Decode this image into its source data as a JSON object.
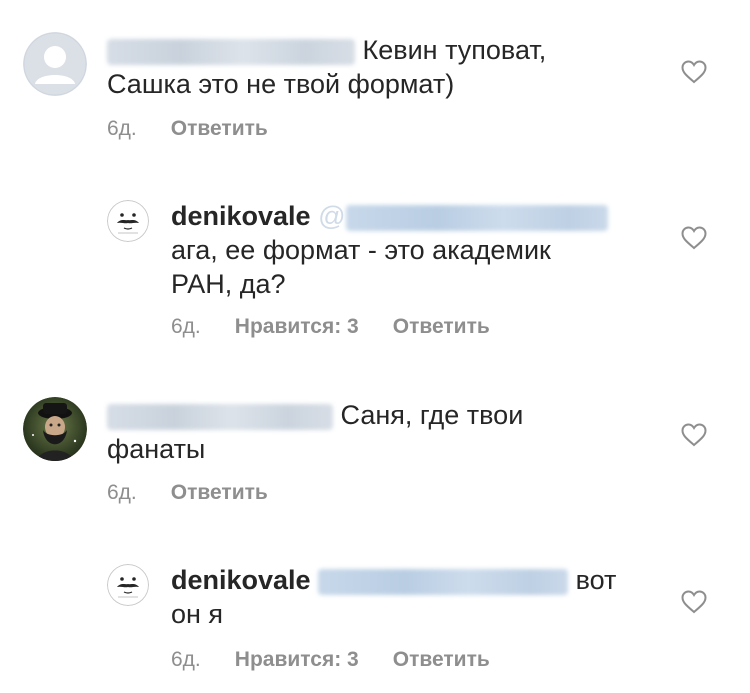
{
  "comments": [
    {
      "type": "comment",
      "text": "Кевин туповат, Сашка это не твой формат)",
      "line1": "Кевин туповат,",
      "line2": "Сашка это не твой формат)",
      "time": "6д.",
      "reply_label": "Ответить"
    },
    {
      "type": "reply",
      "username": "denikovale",
      "mention_prefix": "@",
      "line1": "ага, ее формат - это академик",
      "line2": "РАН, да?",
      "time": "6д.",
      "likes_label": "Нравится: 3",
      "reply_label": "Ответить"
    },
    {
      "type": "comment",
      "line1": "Саня, где твои",
      "line2": "фанаты",
      "time": "6д.",
      "reply_label": "Ответить"
    },
    {
      "type": "reply",
      "username": "denikovale",
      "line1_suffix": "вот",
      "line2": "он я",
      "time": "6д.",
      "likes_label": "Нравится: 3",
      "reply_label": "Ответить"
    }
  ],
  "icons": {
    "heart": "heart-outline-icon",
    "default_avatar": "default-user-avatar-icon",
    "brand_avatar": "mustache-face-avatar",
    "photo_avatar": "user-photo-avatar"
  },
  "colors": {
    "text": "#262626",
    "meta": "#8e8e8e",
    "blurred_username": "#cfd6df",
    "blurred_mention": "#c4d5e8"
  }
}
